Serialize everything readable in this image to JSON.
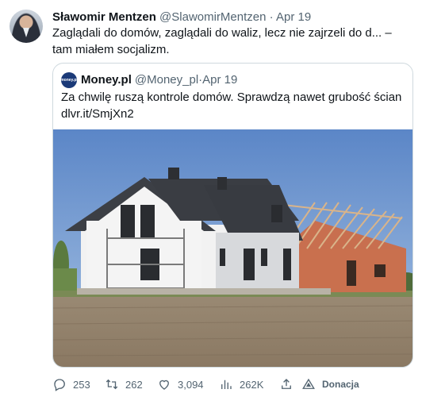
{
  "tweet": {
    "author_name": "Sławomir Mentzen",
    "author_handle": "@SlawomirMentzen",
    "separator": "·",
    "date": "Apr 19",
    "text": "Zaglądali do domów, zaglądali do waliz, lecz nie zajrzeli do d... – tam miałem socjalizm."
  },
  "quote": {
    "author_name": "Money.pl",
    "author_handle": "@Money_pl",
    "separator": "·",
    "date": "Apr 19",
    "logo_text": "money.pl",
    "text_line1": "Za chwilę ruszą kontrole domów. Sprawdzą nawet grubość ścian",
    "text_line2": "dlvr.it/SmjXn2",
    "image_alt_icon": "house-photo"
  },
  "actions": {
    "replies": "253",
    "retweets": "262",
    "likes": "3,094",
    "views": "262K",
    "donate_label": "Donacja"
  },
  "colors": {
    "text": "#0f1419",
    "secondary": "#536471",
    "border": "#cfd9de"
  }
}
